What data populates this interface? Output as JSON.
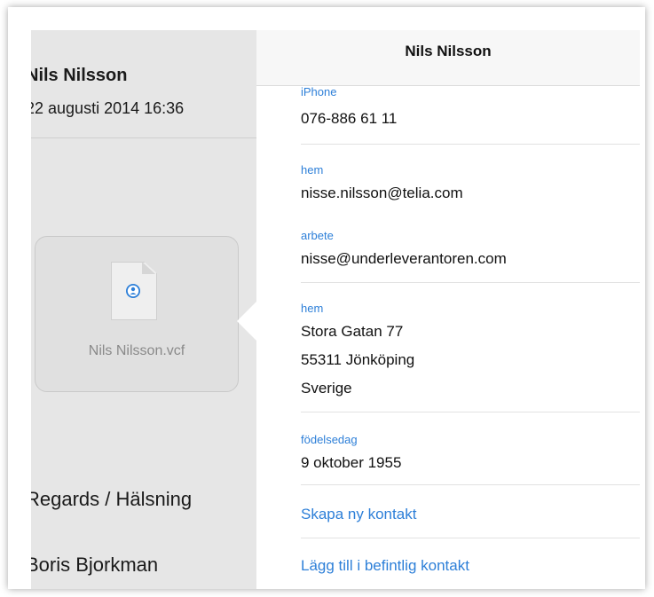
{
  "mail": {
    "sender": "Nils Nilsson",
    "date": "22 augusti 2014 16:36",
    "attachment_name": "Nils Nilsson.vcf",
    "closing": "Regards / Hälsning",
    "signer": "Boris Bjorkman"
  },
  "contact_card": {
    "title": "Nils Nilsson",
    "phone": {
      "label": "iPhone",
      "value": "076-886 61 11"
    },
    "email_home": {
      "label": "hem",
      "value": "nisse.nilsson@telia.com"
    },
    "email_work": {
      "label": "arbete",
      "value": "nisse@underleverantoren.com"
    },
    "address": {
      "label": "hem",
      "line1": "Stora Gatan 77",
      "line2": "55311 Jönköping",
      "line3": "Sverige"
    },
    "birthday": {
      "label": "födelsedag",
      "value": "9 oktober 1955"
    },
    "actions": {
      "create_new": "Skapa ny kontakt",
      "add_existing": "Lägg till i befintlig kontakt"
    }
  },
  "colors": {
    "accent": "#2d7fd8",
    "mail_background": "#e6e6e6",
    "card_background": "#ffffff"
  },
  "icons": {
    "attachment": "vcard-document-icon",
    "contact": "contact-person-icon"
  }
}
